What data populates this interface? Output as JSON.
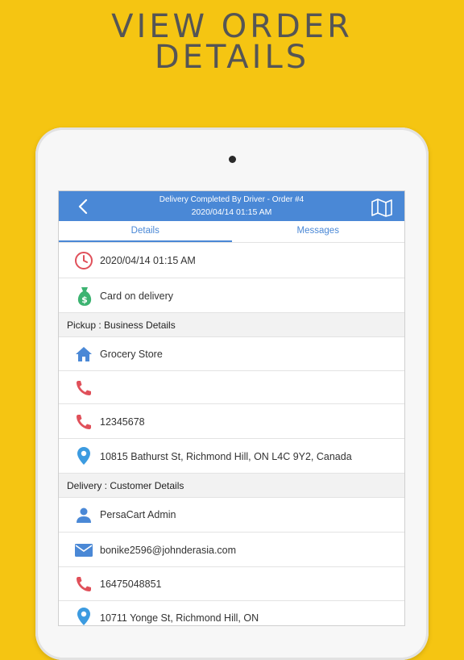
{
  "promo": {
    "line1": "VIEW ORDER",
    "line2": "DETAILS"
  },
  "header": {
    "title": "Delivery Completed By Driver - Order #4",
    "subtitle": "2020/04/14 01:15 AM"
  },
  "tabs": [
    {
      "label": "Details"
    },
    {
      "label": "Messages"
    }
  ],
  "order": {
    "datetime": "2020/04/14 01:15 AM",
    "payment": "Card on delivery"
  },
  "pickup": {
    "section_label": "Pickup : Business Details",
    "business_name": "Grocery Store",
    "phone_1": "",
    "phone_2": "12345678",
    "address": "10815 Bathurst St, Richmond Hill, ON L4C 9Y2, Canada"
  },
  "delivery": {
    "section_label": "Delivery : Customer Details",
    "customer_name": "PersaCart Admin",
    "email": "bonike2596@johnderasia.com",
    "phone": "16475048851",
    "address": "10711 Yonge St, Richmond Hill, ON"
  },
  "colors": {
    "background": "#F5C512",
    "app_bar": "#4A88D6",
    "phone_icon": "#E0505A",
    "location_icon": "#3C9BE0",
    "money_icon": "#3CB371"
  },
  "icons": {
    "back": "chevron-left-icon",
    "map": "map-icon",
    "clock": "clock-icon",
    "payment": "money-bag-icon",
    "home": "home-icon",
    "phone": "phone-icon",
    "location": "location-pin-icon",
    "user": "user-icon",
    "email": "email-icon"
  }
}
